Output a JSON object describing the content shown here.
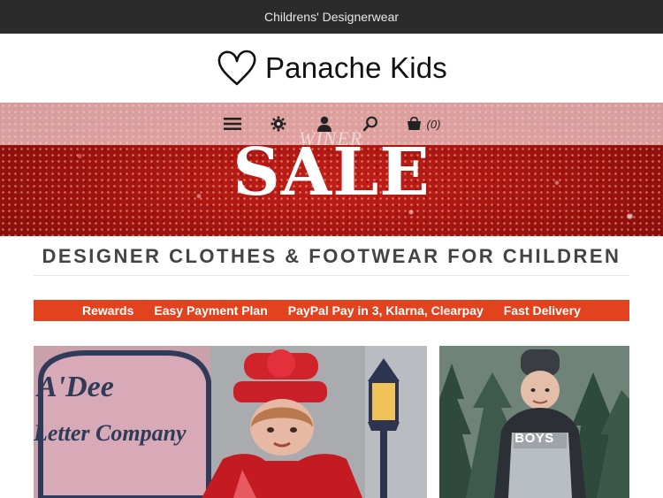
{
  "topbar": {
    "text": "Childrens' Designerwear"
  },
  "brand": {
    "name": "Panache Kids",
    "logo_icon": "heart-outline-icon"
  },
  "nav": {
    "icons": [
      "menu-icon",
      "gear-icon",
      "user-icon",
      "search-icon",
      "cart-icon"
    ],
    "cart_count": "(0)"
  },
  "hero": {
    "subtitle": "WINER",
    "title": "SALE"
  },
  "section": {
    "heading": "DESIGNER CLOTHES & FOOTWEAR FOR CHILDREN"
  },
  "promo": {
    "items": [
      "Rewards",
      "Easy Payment Plan",
      "PayPal Pay in 3, Klarna, Clearpay",
      "Fast Delivery"
    ]
  },
  "tiles": {
    "boys_label": "BOYS",
    "girls_sign_line1": "A'Dee",
    "girls_sign_line2": "Letter Company"
  },
  "colors": {
    "topbar_bg": "#2b2b2b",
    "promo_bg": "#e2431f",
    "hero_red": "#c31f17",
    "nav_overlay": "#f5d7d7"
  }
}
